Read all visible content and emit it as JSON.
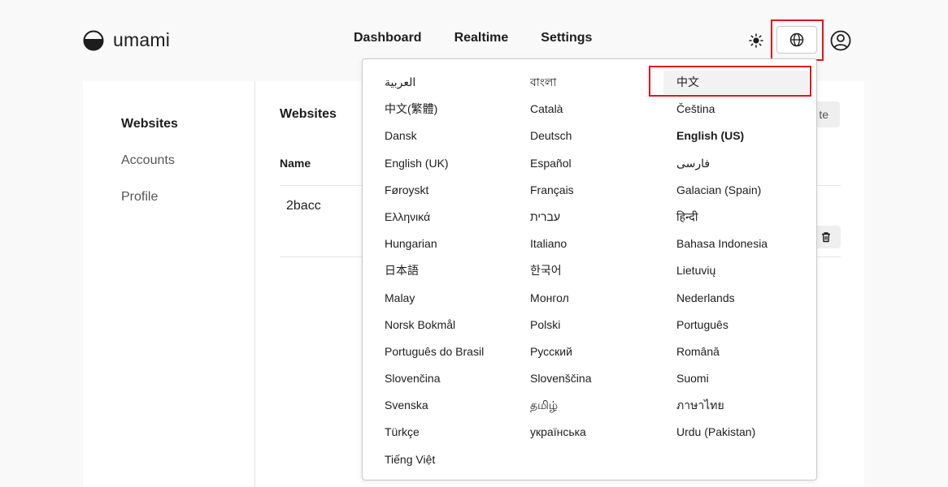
{
  "app": {
    "name": "umami"
  },
  "nav": {
    "items": [
      "Dashboard",
      "Realtime",
      "Settings"
    ]
  },
  "header": {
    "theme_icon": "sun-icon",
    "language_icon": "globe-icon",
    "user_icon": "user-circle-icon"
  },
  "sidebar": {
    "items": [
      "Websites",
      "Accounts",
      "Profile"
    ],
    "active": "Websites"
  },
  "content": {
    "title": "Websites",
    "create_label_partial": "te",
    "columns": [
      "Name"
    ],
    "rows": [
      {
        "name": "2bacc"
      }
    ],
    "delete_icon": "trash-icon"
  },
  "language_menu": {
    "selected": "中文",
    "current": "English (US)",
    "columns": [
      [
        "العربية",
        "中文(繁體)",
        "Dansk",
        "English (UK)",
        "Føroyskt",
        "Ελληνικά",
        "Hungarian",
        "日本語",
        "Malay",
        "Norsk Bokmål",
        "Português do Brasil",
        "Slovenčina",
        "Svenska",
        "Türkçe",
        "Tiếng Việt"
      ],
      [
        "বাংলা",
        "Català",
        "Deutsch",
        "Español",
        "Français",
        "עברית",
        "Italiano",
        "한국어",
        "Монгол",
        "Polski",
        "Русский",
        "Slovenščina",
        "தமிழ்",
        "українська"
      ],
      [
        "中文",
        "Čeština",
        "English (US)",
        "فارسی",
        "Galacian (Spain)",
        "हिन्दी",
        "Bahasa Indonesia",
        "Lietuvių",
        "Nederlands",
        "Português",
        "Română",
        "Suomi",
        "ภาษาไทย",
        "Urdu (Pakistan)"
      ]
    ]
  },
  "colors": {
    "highlight": "#e0161c",
    "text": "#1d1d1d",
    "background": "#f9f9f9"
  }
}
